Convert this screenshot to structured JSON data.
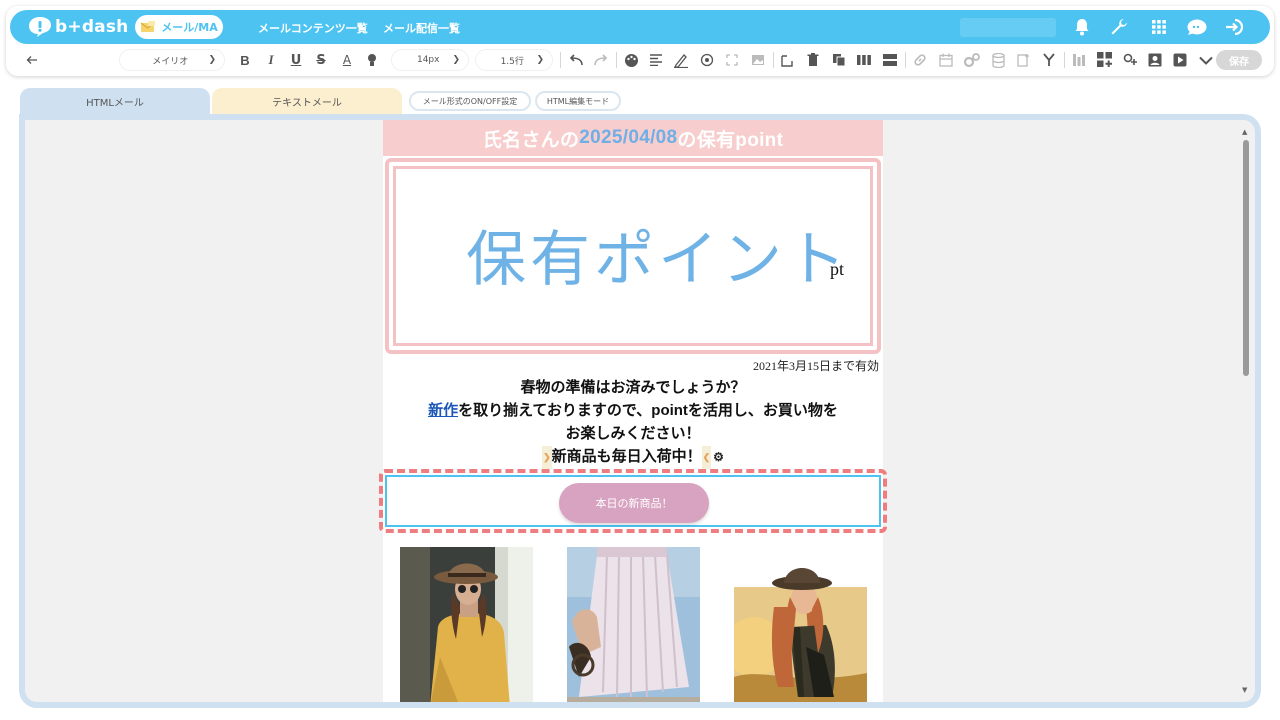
{
  "header": {
    "logo_text": "b+dash",
    "nav_active": "メール/MA",
    "nav_links": [
      "メールコンテンツ一覧",
      "メール配信一覧"
    ]
  },
  "toolbar": {
    "font_select": "メイリオ",
    "size_select": "14px",
    "line_height_select": "1.5行",
    "save_label": "保存"
  },
  "tabs": {
    "html": "HTMLメール",
    "text": "テキストメール",
    "onoff": "メール形式のON/OFF設定",
    "edit_mode": "HTML編集モード"
  },
  "email": {
    "head_part1": "氏名さんの",
    "head_date": "2025/04/08",
    "head_part2": "の保有point",
    "hero_title": "保有ポイント",
    "hero_unit": "pt",
    "expiry": "2021年3月15日まで有効",
    "line1": "春物の準備はお済みでしょうか？",
    "line2_link": "新作",
    "line2_rest": "を取り揃えておりますので、pointを活用し、お買い物を",
    "line3": "お楽しみください！",
    "line4": "新商品も毎日入荷中！",
    "cta_label": "本日の新商品！"
  },
  "colors": {
    "brand": "#4dc3f1",
    "head_bg": "#f7cdcd",
    "accent_blue": "#70aee6",
    "cta_bg": "#d8a3c0",
    "selection": "#ef7d7f"
  }
}
